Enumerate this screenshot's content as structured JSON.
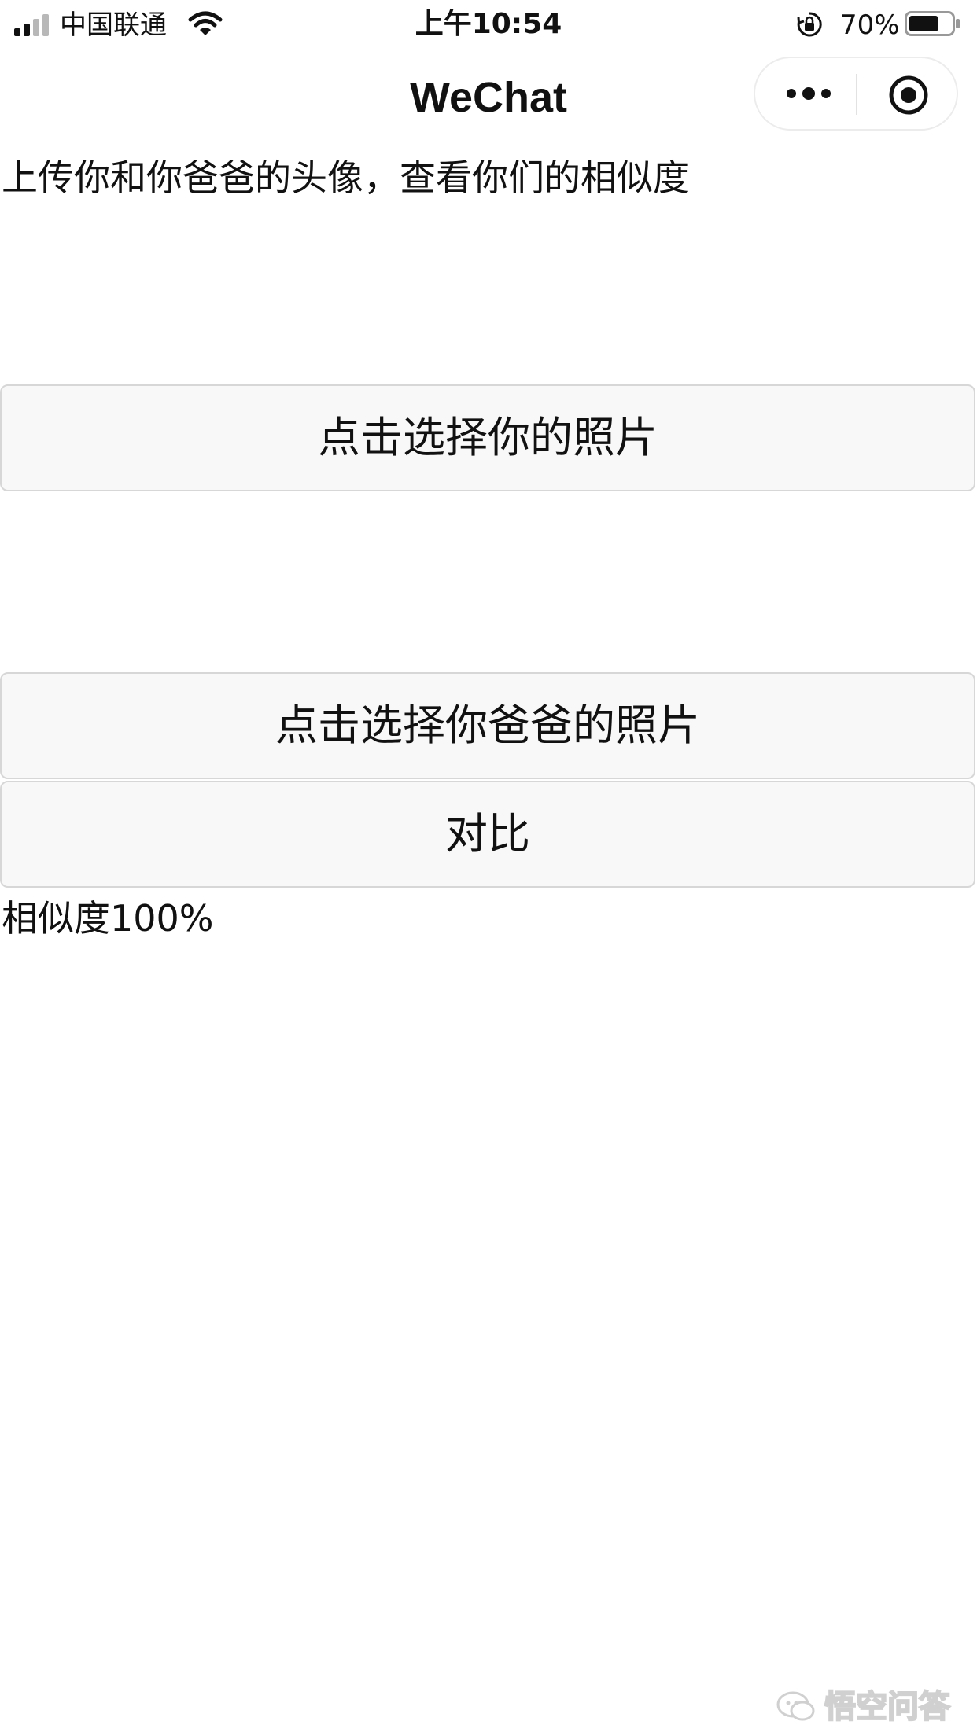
{
  "status_bar": {
    "carrier": "中国联通",
    "time": "上午10:54",
    "battery_percent": "70%",
    "battery_level": 0.7,
    "signal_bars_filled": 2,
    "signal_bars_total": 4,
    "icons": [
      "signal-icon",
      "wifi-icon",
      "rotation-lock-icon",
      "battery-icon"
    ]
  },
  "nav": {
    "title": "WeChat",
    "more_icon": "more-dots-icon",
    "close_icon": "close-target-icon"
  },
  "main": {
    "intro_text": "上传你和你爸爸的头像，查看你们的相似度",
    "select_your_photo_label": "点击选择你的照片",
    "select_dad_photo_label": "点击选择你爸爸的照片",
    "compare_label": "对比",
    "result_text": "相似度100%"
  },
  "watermark": {
    "text": "悟空问答"
  },
  "colors": {
    "background": "#ffffff",
    "button_bg": "#f8f8f8",
    "button_border": "#d7d7d7",
    "text": "#111111"
  }
}
